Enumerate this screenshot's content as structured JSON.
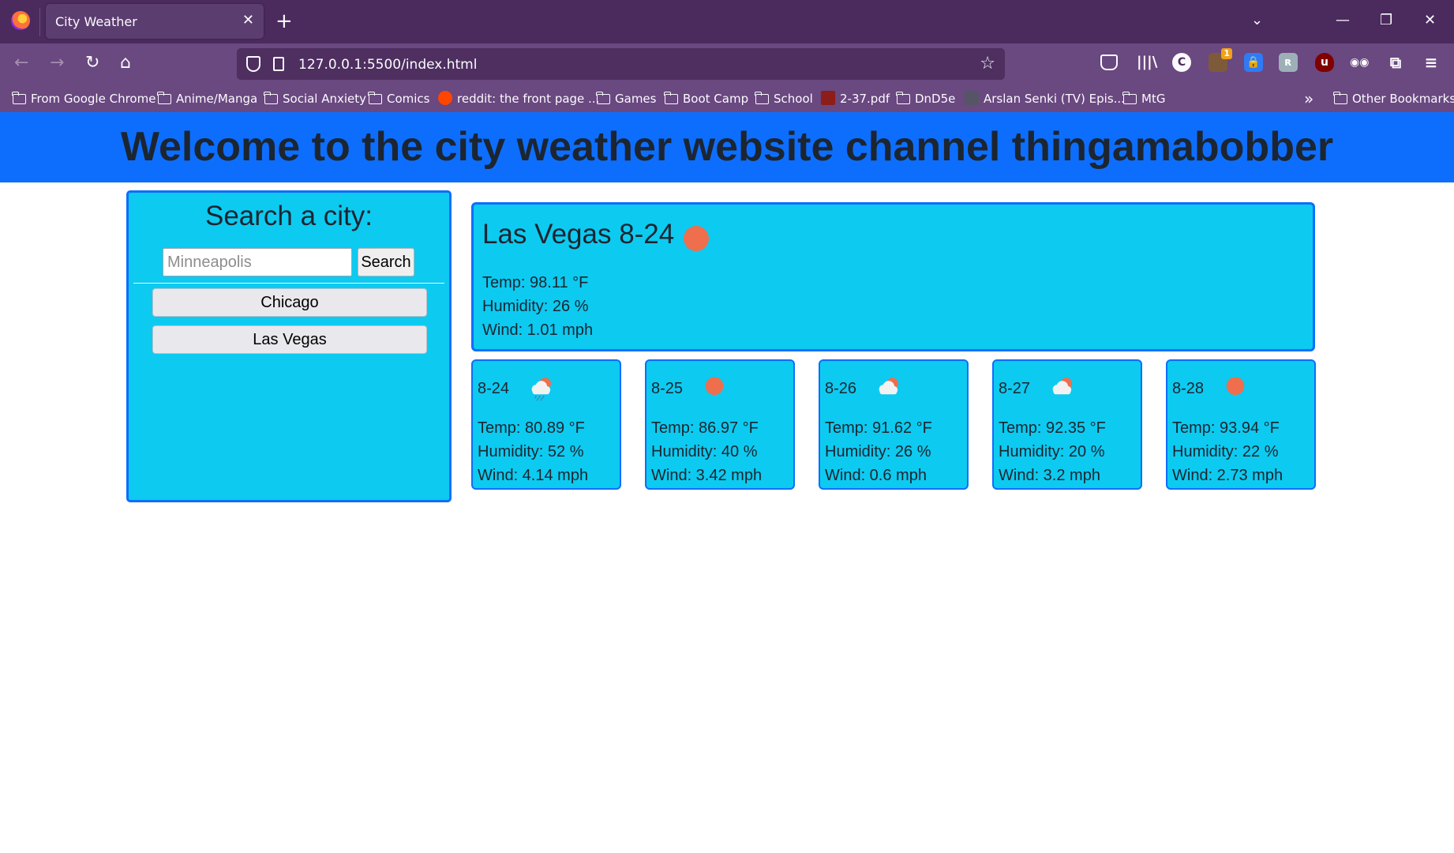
{
  "browser": {
    "tab_title": "City Weather",
    "url": "127.0.0.1:5500/index.html",
    "bookmarks": [
      {
        "label": "From Google Chrome",
        "kind": "folder"
      },
      {
        "label": "Anime/Manga",
        "kind": "folder"
      },
      {
        "label": "Social Anxiety",
        "kind": "folder"
      },
      {
        "label": "Comics",
        "kind": "folder"
      },
      {
        "label": "reddit: the front page ...",
        "kind": "site"
      },
      {
        "label": "Games",
        "kind": "folder"
      },
      {
        "label": "Boot Camp",
        "kind": "folder"
      },
      {
        "label": "School",
        "kind": "folder"
      },
      {
        "label": "2-37.pdf",
        "kind": "site"
      },
      {
        "label": "DnD5e",
        "kind": "folder"
      },
      {
        "label": "Arslan Senki (TV) Epis...",
        "kind": "site"
      },
      {
        "label": "MtG",
        "kind": "folder"
      },
      {
        "label": "Other Bookmarks",
        "kind": "folder"
      }
    ],
    "extension_badge": "1"
  },
  "page": {
    "title": "Welcome to the city weather website channel thingamabobber"
  },
  "search": {
    "heading": "Search a city:",
    "placeholder": "Minneapolis",
    "button_label": "Search",
    "history": [
      "Chicago",
      "Las Vegas"
    ]
  },
  "current": {
    "title": "Las Vegas 8-24",
    "icon": "sun-icon",
    "temp": "Temp: 98.11 °F",
    "humidity": "Humidity: 26 %",
    "wind": "Wind: 1.01 mph"
  },
  "forecast": [
    {
      "date": "8-24",
      "icon": "rain-cloud-icon",
      "temp": "Temp: 80.89 °F",
      "humidity": "Humidity: 52 %",
      "wind": "Wind: 4.14 mph"
    },
    {
      "date": "8-25",
      "icon": "sun-icon",
      "temp": "Temp: 86.97 °F",
      "humidity": "Humidity: 40 %",
      "wind": "Wind: 3.42 mph"
    },
    {
      "date": "8-26",
      "icon": "partly-cloudy-icon",
      "temp": "Temp: 91.62 °F",
      "humidity": "Humidity: 26 %",
      "wind": "Wind: 0.6 mph"
    },
    {
      "date": "8-27",
      "icon": "partly-cloudy-icon",
      "temp": "Temp: 92.35 °F",
      "humidity": "Humidity: 20 %",
      "wind": "Wind: 3.2 mph"
    },
    {
      "date": "8-28",
      "icon": "sun-icon",
      "temp": "Temp: 93.94 °F",
      "humidity": "Humidity: 22 %",
      "wind": "Wind: 2.73 mph"
    }
  ],
  "colors": {
    "header": "#0d6efd",
    "card": "#0dcaf0",
    "card_border": "#0d6efd",
    "sun": "#ee6e4e"
  }
}
